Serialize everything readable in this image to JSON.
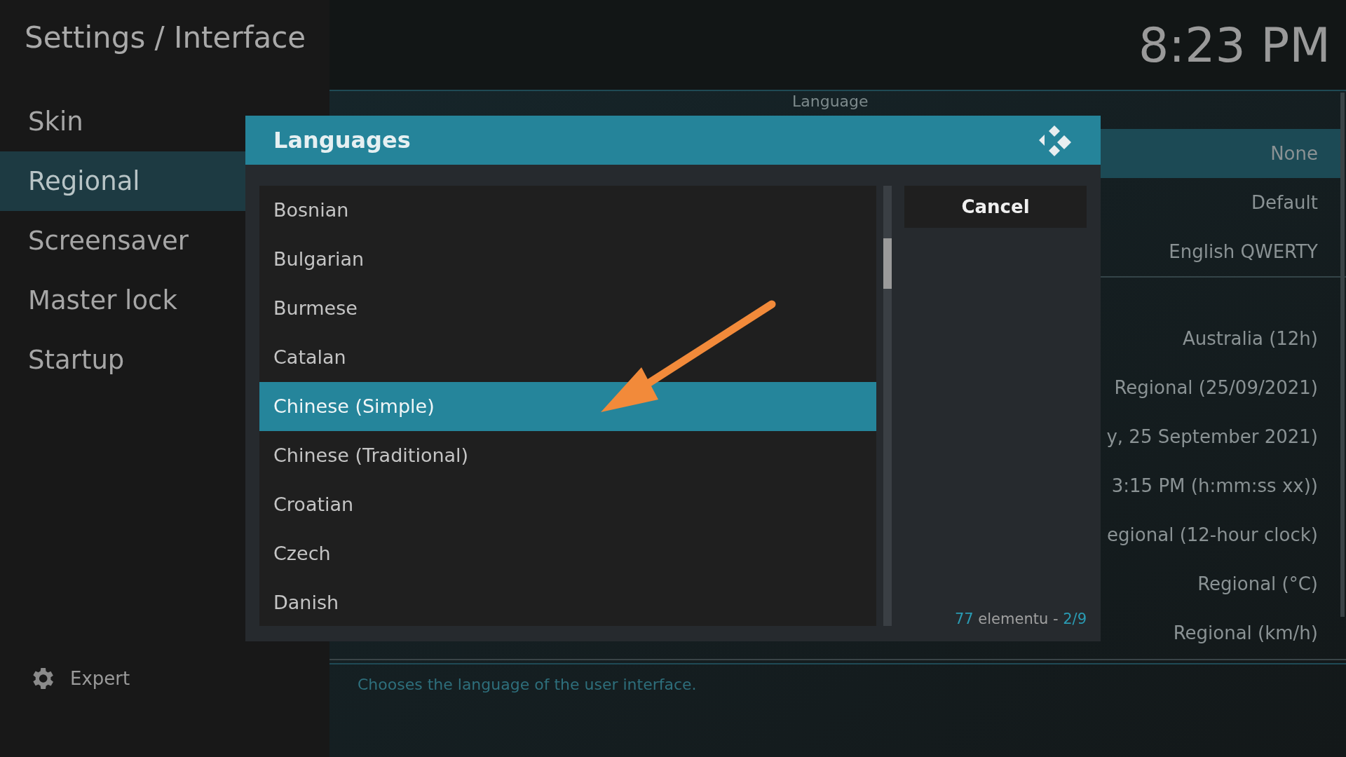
{
  "header": {
    "title": "Settings / Interface",
    "clock": "8:23 PM"
  },
  "sidebar": {
    "items": [
      {
        "label": "Skin",
        "selected": false
      },
      {
        "label": "Regional",
        "selected": true
      },
      {
        "label": "Screensaver",
        "selected": false
      },
      {
        "label": "Master lock",
        "selected": false
      },
      {
        "label": "Startup",
        "selected": false
      }
    ],
    "level_button": {
      "label": "Expert"
    }
  },
  "settings": {
    "section_title": "Language",
    "groups": [
      {
        "rows": [
          {
            "value": "None",
            "selected": true
          },
          {
            "value": "Default",
            "selected": false
          },
          {
            "value": "English QWERTY",
            "selected": false
          }
        ]
      },
      {
        "rows": [
          {
            "value": "Australia (12h)",
            "selected": false
          },
          {
            "value": "Regional (25/09/2021)",
            "selected": false
          },
          {
            "value": "y, 25 September 2021)",
            "selected": false
          },
          {
            "value": "3:15 PM (h:mm:ss xx))",
            "selected": false
          },
          {
            "value": "egional (12-hour clock)",
            "selected": false
          },
          {
            "value": "Regional (°C)",
            "selected": false
          },
          {
            "value": "Regional (km/h)",
            "selected": false
          }
        ]
      }
    ]
  },
  "description": "Chooses the language of the user interface.",
  "dialog": {
    "title": "Languages",
    "items": [
      {
        "label": "Bosnian",
        "selected": false
      },
      {
        "label": "Bulgarian",
        "selected": false
      },
      {
        "label": "Burmese",
        "selected": false
      },
      {
        "label": "Catalan",
        "selected": false
      },
      {
        "label": "Chinese (Simple)",
        "selected": true
      },
      {
        "label": "Chinese (Traditional)",
        "selected": false
      },
      {
        "label": "Croatian",
        "selected": false
      },
      {
        "label": "Czech",
        "selected": false
      },
      {
        "label": "Danish",
        "selected": false
      }
    ],
    "cancel": "Cancel",
    "count": {
      "number": "77",
      "label": "elementu -",
      "page": "2/9"
    }
  }
}
